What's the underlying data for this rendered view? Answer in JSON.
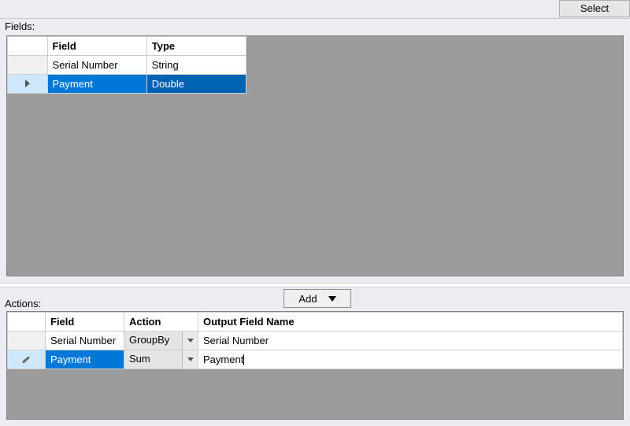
{
  "toolbar": {
    "select_label": "Select"
  },
  "fields_section": {
    "label": "Fields:",
    "columns": {
      "field": "Field",
      "type": "Type"
    },
    "rows": [
      {
        "field": "Serial Number",
        "type": "String",
        "selected": false
      },
      {
        "field": "Payment",
        "type": "Double",
        "selected": true
      }
    ]
  },
  "actions_section": {
    "label": "Actions:",
    "add_label": "Add",
    "columns": {
      "field": "Field",
      "action": "Action",
      "output": "Output Field Name"
    },
    "rows": [
      {
        "field": "Serial Number",
        "action": "GroupBy",
        "output": "Serial Number",
        "selected": false,
        "editing": false
      },
      {
        "field": "Payment",
        "action": "Sum",
        "output": "Payment",
        "selected": true,
        "editing": true
      }
    ]
  }
}
